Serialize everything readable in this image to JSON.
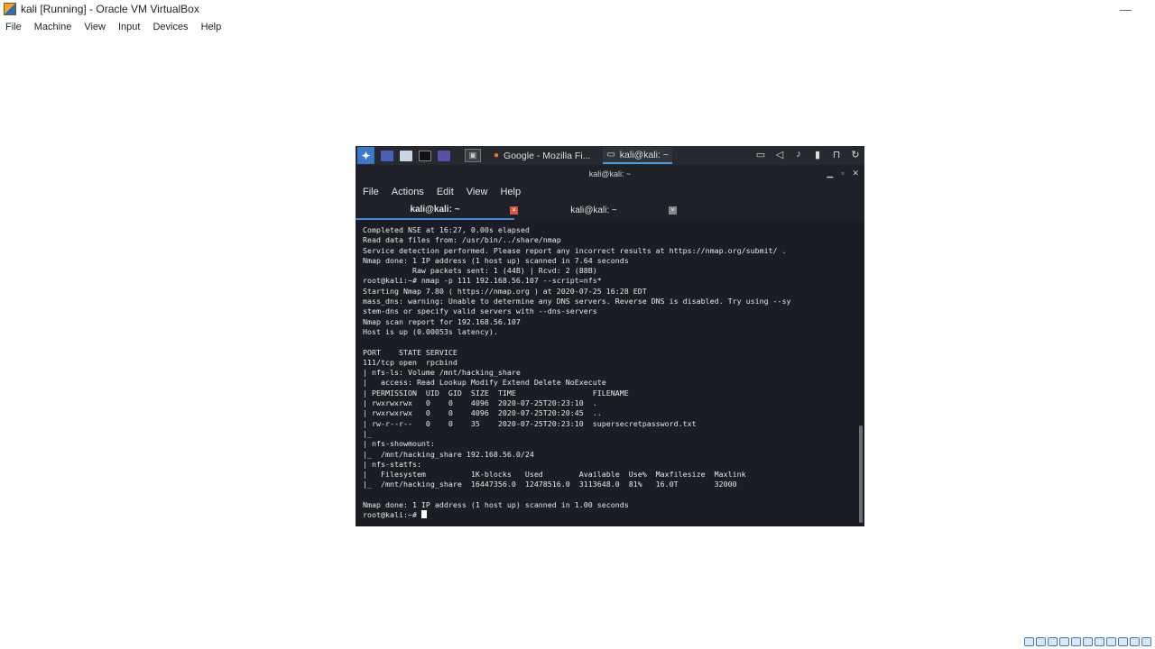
{
  "window": {
    "title": "kali [Running] - Oracle VM VirtualBox",
    "minimize": "—"
  },
  "vbox_menu": [
    "File",
    "Machine",
    "View",
    "Input",
    "Devices",
    "Help"
  ],
  "guest": {
    "taskbar": {
      "tasks": [
        {
          "label": "Google - Mozilla Fi...",
          "icon": "firefox-icon"
        },
        {
          "label": "kali@kali: ~",
          "icon": "terminal-icon"
        }
      ]
    },
    "terminal": {
      "title": "kali@kali: ~",
      "menu": [
        "File",
        "Actions",
        "Edit",
        "View",
        "Help"
      ],
      "tabs": [
        "kali@kali: ~",
        "kali@kali: ~"
      ],
      "lines": [
        "Completed NSE at 16:27, 0.00s elapsed",
        "Read data files from: /usr/bin/../share/nmap",
        "Service detection performed. Please report any incorrect results at https://nmap.org/submit/ .",
        "Nmap done: 1 IP address (1 host up) scanned in 7.64 seconds",
        "           Raw packets sent: 1 (44B) | Rcvd: 2 (88B)",
        "root@kali:~# nmap -p 111 192.168.56.107 --script=nfs*",
        "Starting Nmap 7.80 ( https://nmap.org ) at 2020-07-25 16:28 EDT",
        "mass_dns: warning: Unable to determine any DNS servers. Reverse DNS is disabled. Try using --sy",
        "stem-dns or specify valid servers with --dns-servers",
        "Nmap scan report for 192.168.56.107",
        "Host is up (0.00053s latency).",
        "",
        "PORT    STATE SERVICE",
        "111/tcp open  rpcbind",
        "| nfs-ls: Volume /mnt/hacking_share",
        "|   access: Read Lookup Modify Extend Delete NoExecute",
        "| PERMISSION  UID  GID  SIZE  TIME                 FILENAME",
        "| rwxrwxrwx   0    0    4096  2020-07-25T20:23:10  .",
        "| rwxrwxrwx   0    0    4096  2020-07-25T20:20:45  ..",
        "| rw-r--r--   0    0    35    2020-07-25T20:23:10  supersecretpassword.txt",
        "|_",
        "| nfs-showmount:",
        "|_  /mnt/hacking_share 192.168.56.0/24",
        "| nfs-statfs:",
        "|   Filesystem          1K-blocks   Used        Available  Use%  Maxfilesize  Maxlink",
        "|_  /mnt/hacking_share  16447356.0  12478516.0  3113648.0  81%   16.0T        32000",
        "",
        "Nmap done: 1 IP address (1 host up) scanned in 1.00 seconds"
      ],
      "prompt": "root@kali:~# "
    }
  }
}
